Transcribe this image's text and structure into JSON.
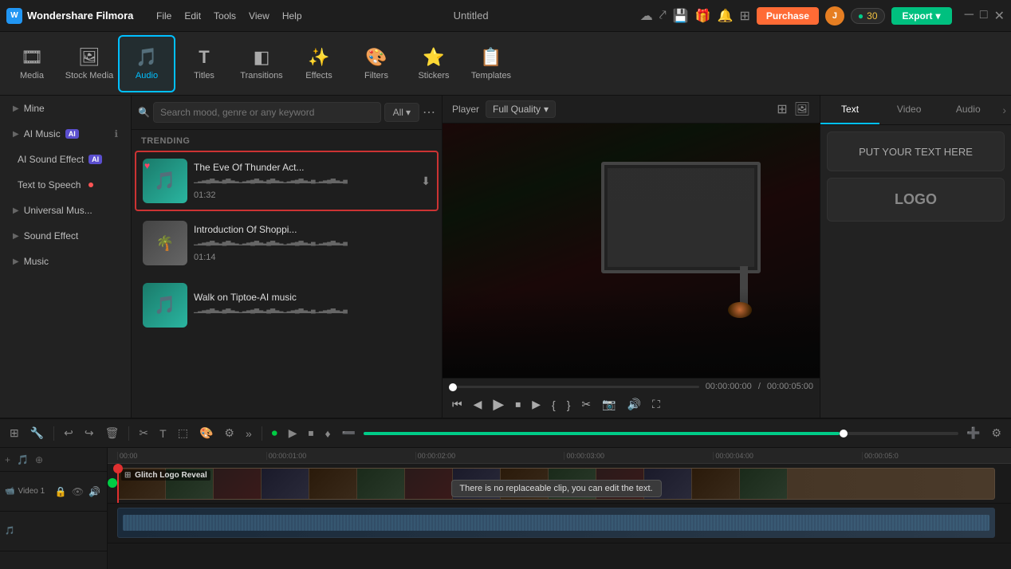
{
  "app": {
    "name": "Wondershare Filmora",
    "title": "Untitled"
  },
  "menu": [
    "File",
    "Edit",
    "Tools",
    "View",
    "Help"
  ],
  "purchase": {
    "label": "Purchase"
  },
  "coins": {
    "count": "30"
  },
  "export": {
    "label": "Export"
  },
  "toolbar": {
    "items": [
      {
        "id": "media",
        "label": "Media",
        "icon": "🎞"
      },
      {
        "id": "stock-media",
        "label": "Stock Media",
        "icon": "🖼"
      },
      {
        "id": "audio",
        "label": "Audio",
        "icon": "🎵"
      },
      {
        "id": "titles",
        "label": "Titles",
        "icon": "T"
      },
      {
        "id": "transitions",
        "label": "Transitions",
        "icon": "⬛"
      },
      {
        "id": "effects",
        "label": "Effects",
        "icon": "✨"
      },
      {
        "id": "filters",
        "label": "Filters",
        "icon": "🎨"
      },
      {
        "id": "stickers",
        "label": "Stickers",
        "icon": "⭐"
      },
      {
        "id": "templates",
        "label": "Templates",
        "icon": "📋"
      }
    ]
  },
  "sidebar": {
    "items": [
      {
        "id": "mine",
        "label": "Mine",
        "hasChevron": true
      },
      {
        "id": "ai-music",
        "label": "AI Music",
        "badge": "AI",
        "hasInfo": true
      },
      {
        "id": "ai-sound-effect",
        "label": "AI Sound Effect",
        "badge": "AI"
      },
      {
        "id": "text-to-speech",
        "label": "Text to Speech",
        "hasDot": true
      },
      {
        "id": "universal-music",
        "label": "Universal Mus...",
        "hasChevron": true
      },
      {
        "id": "sound-effect",
        "label": "Sound Effect",
        "hasChevron": true
      },
      {
        "id": "music",
        "label": "Music",
        "hasChevron": true
      }
    ]
  },
  "audio": {
    "search_placeholder": "Search mood, genre or any keyword",
    "filter_label": "All",
    "trending_label": "TRENDING",
    "items": [
      {
        "id": "1",
        "title": "The Eve Of Thunder Act...",
        "duration": "01:32",
        "wave": "▁▂▃▄▅▃▂▄▅▃▂▁▂▃▄▅▃▂▄▅▃▂▁▂▃▄▅▃▂▄",
        "color": "teal",
        "has_heart": true,
        "has_download": true
      },
      {
        "id": "2",
        "title": "Introduction Of Shoppi...",
        "duration": "01:14",
        "wave": "▁▂▃▄▅▃▂▄▅▃▂▁▂▃▄▅▃▂▄▅▃▂▁▂▃▄▅▃▂▄",
        "color": "gray",
        "has_heart": false,
        "has_download": false
      },
      {
        "id": "3",
        "title": "Walk on Tiptoe-AI music",
        "duration": "",
        "wave": "▁▂▃▄▅▃▂▄▅▃▂▁▂▃▄▅▃▂▄▅▃▂▁▂▃▄▅▃▂▄",
        "color": "teal",
        "has_heart": false,
        "has_download": false
      }
    ]
  },
  "player": {
    "label": "Player",
    "quality": "Full Quality",
    "current_time": "00:00:00:00",
    "total_time": "00:00:05:00"
  },
  "right_panel": {
    "tabs": [
      "Text",
      "Video",
      "Audio"
    ],
    "active_tab": "Text",
    "presets": [
      {
        "id": "put-your-text",
        "label": "PUT YOUR TEXT HERE"
      },
      {
        "id": "logo",
        "label": "LOGO"
      }
    ]
  },
  "timeline": {
    "timecodes": [
      "00:00",
      "00:00:01:00",
      "00:00:02:00",
      "00:00:03:00",
      "00:00:04:00",
      "00:00:05:0"
    ],
    "tracks": [
      {
        "id": "video1",
        "label": "Video 1",
        "type": "video"
      }
    ],
    "clip": {
      "label": "Glitch Logo Reveal",
      "tooltip": "There is no replaceable clip, you can edit the text."
    }
  }
}
